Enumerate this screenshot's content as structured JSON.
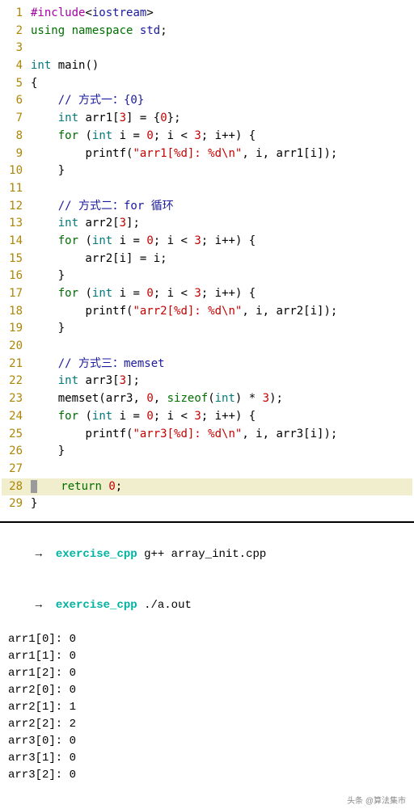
{
  "code": {
    "lines": [
      {
        "n": 1,
        "tokens": [
          {
            "cls": "tok-preproc",
            "t": "#include"
          },
          {
            "cls": "tok-punct",
            "t": "<"
          },
          {
            "cls": "tok-ns",
            "t": "iostream"
          },
          {
            "cls": "tok-punct",
            "t": ">"
          }
        ]
      },
      {
        "n": 2,
        "tokens": [
          {
            "cls": "tok-keyword",
            "t": "using"
          },
          {
            "cls": "",
            "t": " "
          },
          {
            "cls": "tok-keyword",
            "t": "namespace"
          },
          {
            "cls": "",
            "t": " "
          },
          {
            "cls": "tok-ns",
            "t": "std"
          },
          {
            "cls": "tok-punct",
            "t": ";"
          }
        ]
      },
      {
        "n": 3,
        "tokens": []
      },
      {
        "n": 4,
        "tokens": [
          {
            "cls": "tok-type",
            "t": "int"
          },
          {
            "cls": "",
            "t": " "
          },
          {
            "cls": "tok-func",
            "t": "main"
          },
          {
            "cls": "tok-punct",
            "t": "()"
          }
        ]
      },
      {
        "n": 5,
        "tokens": [
          {
            "cls": "tok-punct",
            "t": "{"
          }
        ]
      },
      {
        "n": 6,
        "tokens": [
          {
            "cls": "",
            "t": "    "
          },
          {
            "cls": "tok-comment",
            "t": "// 方式一：{0}"
          }
        ]
      },
      {
        "n": 7,
        "tokens": [
          {
            "cls": "",
            "t": "    "
          },
          {
            "cls": "tok-type",
            "t": "int"
          },
          {
            "cls": "",
            "t": " "
          },
          {
            "cls": "tok-ident",
            "t": "arr1"
          },
          {
            "cls": "tok-punct",
            "t": "["
          },
          {
            "cls": "tok-number",
            "t": "3"
          },
          {
            "cls": "tok-punct",
            "t": "] = {"
          },
          {
            "cls": "tok-number",
            "t": "0"
          },
          {
            "cls": "tok-punct",
            "t": "};"
          }
        ]
      },
      {
        "n": 8,
        "tokens": [
          {
            "cls": "",
            "t": "    "
          },
          {
            "cls": "tok-keyword",
            "t": "for"
          },
          {
            "cls": "",
            "t": " "
          },
          {
            "cls": "tok-punct",
            "t": "("
          },
          {
            "cls": "tok-type",
            "t": "int"
          },
          {
            "cls": "",
            "t": " i = "
          },
          {
            "cls": "tok-number",
            "t": "0"
          },
          {
            "cls": "tok-punct",
            "t": "; i < "
          },
          {
            "cls": "tok-number",
            "t": "3"
          },
          {
            "cls": "tok-punct",
            "t": "; i++) {"
          }
        ]
      },
      {
        "n": 9,
        "tokens": [
          {
            "cls": "",
            "t": "        "
          },
          {
            "cls": "tok-func",
            "t": "printf"
          },
          {
            "cls": "tok-punct",
            "t": "("
          },
          {
            "cls": "tok-string",
            "t": "\"arr1[%d]: %d\\n\""
          },
          {
            "cls": "tok-punct",
            "t": ", i, arr1[i]);"
          }
        ]
      },
      {
        "n": 10,
        "tokens": [
          {
            "cls": "",
            "t": "    "
          },
          {
            "cls": "tok-punct",
            "t": "}"
          }
        ]
      },
      {
        "n": 11,
        "tokens": []
      },
      {
        "n": 12,
        "tokens": [
          {
            "cls": "",
            "t": "    "
          },
          {
            "cls": "tok-comment",
            "t": "// 方式二：for 循环"
          }
        ]
      },
      {
        "n": 13,
        "tokens": [
          {
            "cls": "",
            "t": "    "
          },
          {
            "cls": "tok-type",
            "t": "int"
          },
          {
            "cls": "",
            "t": " "
          },
          {
            "cls": "tok-ident",
            "t": "arr2"
          },
          {
            "cls": "tok-punct",
            "t": "["
          },
          {
            "cls": "tok-number",
            "t": "3"
          },
          {
            "cls": "tok-punct",
            "t": "];"
          }
        ]
      },
      {
        "n": 14,
        "tokens": [
          {
            "cls": "",
            "t": "    "
          },
          {
            "cls": "tok-keyword",
            "t": "for"
          },
          {
            "cls": "",
            "t": " "
          },
          {
            "cls": "tok-punct",
            "t": "("
          },
          {
            "cls": "tok-type",
            "t": "int"
          },
          {
            "cls": "",
            "t": " i = "
          },
          {
            "cls": "tok-number",
            "t": "0"
          },
          {
            "cls": "tok-punct",
            "t": "; i < "
          },
          {
            "cls": "tok-number",
            "t": "3"
          },
          {
            "cls": "tok-punct",
            "t": "; i++) {"
          }
        ]
      },
      {
        "n": 15,
        "tokens": [
          {
            "cls": "",
            "t": "        arr2[i] = i;"
          }
        ]
      },
      {
        "n": 16,
        "tokens": [
          {
            "cls": "",
            "t": "    "
          },
          {
            "cls": "tok-punct",
            "t": "}"
          }
        ]
      },
      {
        "n": 17,
        "tokens": [
          {
            "cls": "",
            "t": "    "
          },
          {
            "cls": "tok-keyword",
            "t": "for"
          },
          {
            "cls": "",
            "t": " "
          },
          {
            "cls": "tok-punct",
            "t": "("
          },
          {
            "cls": "tok-type",
            "t": "int"
          },
          {
            "cls": "",
            "t": " i = "
          },
          {
            "cls": "tok-number",
            "t": "0"
          },
          {
            "cls": "tok-punct",
            "t": "; i < "
          },
          {
            "cls": "tok-number",
            "t": "3"
          },
          {
            "cls": "tok-punct",
            "t": "; i++) {"
          }
        ]
      },
      {
        "n": 18,
        "tokens": [
          {
            "cls": "",
            "t": "        "
          },
          {
            "cls": "tok-func",
            "t": "printf"
          },
          {
            "cls": "tok-punct",
            "t": "("
          },
          {
            "cls": "tok-string",
            "t": "\"arr2[%d]: %d\\n\""
          },
          {
            "cls": "tok-punct",
            "t": ", i, arr2[i]);"
          }
        ]
      },
      {
        "n": 19,
        "tokens": [
          {
            "cls": "",
            "t": "    "
          },
          {
            "cls": "tok-punct",
            "t": "}"
          }
        ]
      },
      {
        "n": 20,
        "tokens": []
      },
      {
        "n": 21,
        "tokens": [
          {
            "cls": "",
            "t": "    "
          },
          {
            "cls": "tok-comment",
            "t": "// 方式三：memset"
          }
        ]
      },
      {
        "n": 22,
        "tokens": [
          {
            "cls": "",
            "t": "    "
          },
          {
            "cls": "tok-type",
            "t": "int"
          },
          {
            "cls": "",
            "t": " "
          },
          {
            "cls": "tok-ident",
            "t": "arr3"
          },
          {
            "cls": "tok-punct",
            "t": "["
          },
          {
            "cls": "tok-number",
            "t": "3"
          },
          {
            "cls": "tok-punct",
            "t": "];"
          }
        ]
      },
      {
        "n": 23,
        "tokens": [
          {
            "cls": "",
            "t": "    "
          },
          {
            "cls": "tok-func",
            "t": "memset"
          },
          {
            "cls": "tok-punct",
            "t": "(arr3, "
          },
          {
            "cls": "tok-number",
            "t": "0"
          },
          {
            "cls": "tok-punct",
            "t": ", "
          },
          {
            "cls": "tok-keyword",
            "t": "sizeof"
          },
          {
            "cls": "tok-punct",
            "t": "("
          },
          {
            "cls": "tok-type",
            "t": "int"
          },
          {
            "cls": "tok-punct",
            "t": ") * "
          },
          {
            "cls": "tok-number",
            "t": "3"
          },
          {
            "cls": "tok-punct",
            "t": ");"
          }
        ]
      },
      {
        "n": 24,
        "tokens": [
          {
            "cls": "",
            "t": "    "
          },
          {
            "cls": "tok-keyword",
            "t": "for"
          },
          {
            "cls": "",
            "t": " "
          },
          {
            "cls": "tok-punct",
            "t": "("
          },
          {
            "cls": "tok-type",
            "t": "int"
          },
          {
            "cls": "",
            "t": " i = "
          },
          {
            "cls": "tok-number",
            "t": "0"
          },
          {
            "cls": "tok-punct",
            "t": "; i < "
          },
          {
            "cls": "tok-number",
            "t": "3"
          },
          {
            "cls": "tok-punct",
            "t": "; i++) {"
          }
        ]
      },
      {
        "n": 25,
        "tokens": [
          {
            "cls": "",
            "t": "        "
          },
          {
            "cls": "tok-func",
            "t": "printf"
          },
          {
            "cls": "tok-punct",
            "t": "("
          },
          {
            "cls": "tok-string",
            "t": "\"arr3[%d]: %d\\n\""
          },
          {
            "cls": "tok-punct",
            "t": ", i, arr3[i]);"
          }
        ]
      },
      {
        "n": 26,
        "tokens": [
          {
            "cls": "",
            "t": "    "
          },
          {
            "cls": "tok-punct",
            "t": "}"
          }
        ]
      },
      {
        "n": 27,
        "tokens": []
      },
      {
        "n": 28,
        "cursor": true,
        "tokens": [
          {
            "cls": "",
            "t": "   "
          },
          {
            "cls": "tok-keyword",
            "t": "return"
          },
          {
            "cls": "",
            "t": " "
          },
          {
            "cls": "tok-number",
            "t": "0"
          },
          {
            "cls": "tok-punct",
            "t": ";"
          }
        ]
      },
      {
        "n": 29,
        "tokens": [
          {
            "cls": "tok-punct",
            "t": "}"
          }
        ]
      }
    ]
  },
  "terminal": {
    "prompt_arrow": "→",
    "cwd": "exercise_cpp",
    "cmd1": "g++ array_init.cpp",
    "cmd2": "./a.out",
    "output": [
      "arr1[0]: 0",
      "arr1[1]: 0",
      "arr1[2]: 0",
      "arr2[0]: 0",
      "arr2[1]: 1",
      "arr2[2]: 2",
      "arr3[0]: 0",
      "arr3[1]: 0",
      "arr3[2]: 0"
    ]
  },
  "watermark": "头条 @算法集市"
}
